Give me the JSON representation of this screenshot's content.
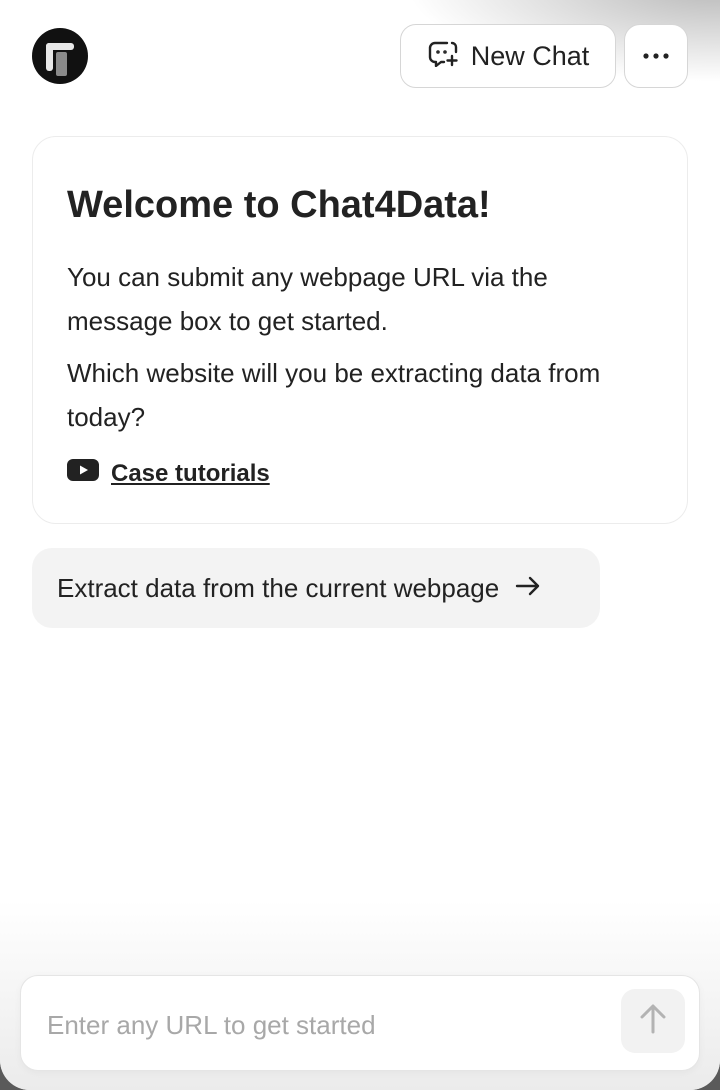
{
  "header": {
    "logo_icon": "app-logo-icon",
    "new_chat_label": "New Chat",
    "new_chat_icon": "chat-plus-icon",
    "more_icon": "more-dots-icon"
  },
  "welcome": {
    "title": "Welcome to Chat4Data!",
    "paragraph_1": "You can submit any webpage URL via the message box to get started.",
    "paragraph_2": "Which website will you be extracting data from today?",
    "tutorial_icon": "youtube-icon",
    "tutorial_label": "Case tutorials"
  },
  "suggestion": {
    "label": "Extract data from the current webpage",
    "icon": "arrow-right-icon"
  },
  "composer": {
    "placeholder": "Enter any URL to get started",
    "value": "",
    "send_icon": "arrow-up-icon"
  },
  "colors": {
    "accent": "#111111",
    "border": "#d6d6d6",
    "suggestion_bg": "#f3f3f3",
    "placeholder": "#a8a8a8"
  }
}
